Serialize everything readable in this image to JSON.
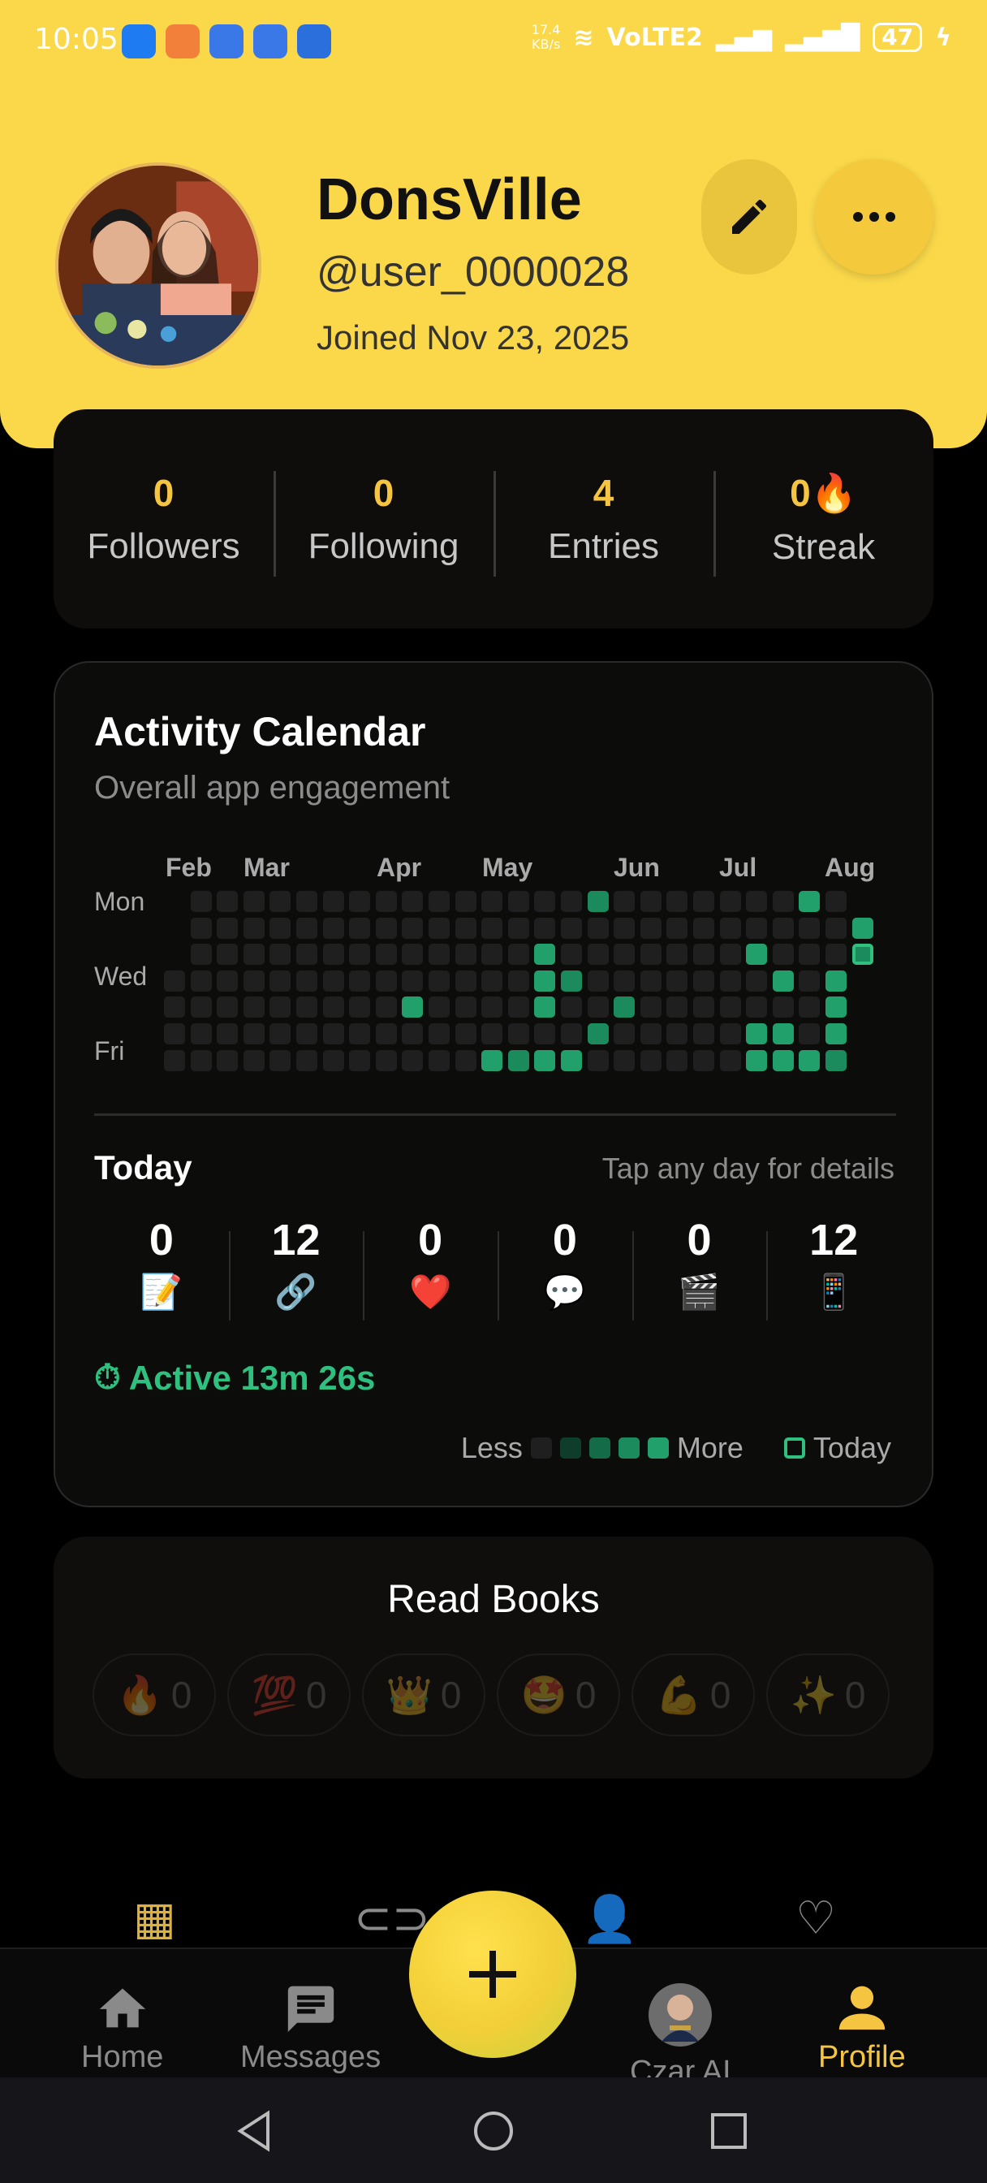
{
  "status_bar": {
    "time": "10:05",
    "speed_value": "17.4",
    "speed_unit": "KB/s",
    "network": "VoLTE2",
    "battery": "47"
  },
  "profile": {
    "name": "DonsVille",
    "handle": "@user_0000028",
    "joined": "Joined Nov 23, 2025",
    "edit_icon": "pencil-icon",
    "more_icon": "more-horizontal-icon"
  },
  "stats": [
    {
      "value": "0",
      "label": "Followers"
    },
    {
      "value": "0",
      "label": "Following"
    },
    {
      "value": "4",
      "label": "Entries"
    },
    {
      "value": "0🔥",
      "label": "Streak"
    }
  ],
  "activity": {
    "title": "Activity Calendar",
    "subtitle": "Overall app engagement",
    "months": [
      "Feb",
      "Mar",
      "Apr",
      "May",
      "Jun",
      "Jul",
      "Aug"
    ],
    "day_labels": [
      "Mon",
      "Wed",
      "Fri"
    ],
    "colors": {
      "empty": "#1f1f1f",
      "level1": "#0f3d2c",
      "level2": "#146b47",
      "level3": "#1b8a5c",
      "level4": "#22a06b",
      "today_border": "#2fbf7f"
    },
    "today_label": "Today",
    "hint": "Tap any day for details",
    "metrics": [
      {
        "value": "0",
        "icon": "📝"
      },
      {
        "value": "12",
        "icon": "🔗"
      },
      {
        "value": "0",
        "icon": "❤️"
      },
      {
        "value": "0",
        "icon": "💬"
      },
      {
        "value": "0",
        "icon": "🎬"
      },
      {
        "value": "12",
        "icon": "📱"
      }
    ],
    "active_text": "Active 13m 26s",
    "legend_less": "Less",
    "legend_more": "More",
    "legend_today": "Today"
  },
  "books": {
    "title": "Read Books",
    "reactions": [
      {
        "emoji": "🔥",
        "count": "0"
      },
      {
        "emoji": "💯",
        "count": "0"
      },
      {
        "emoji": "👑",
        "count": "0"
      },
      {
        "emoji": "🤩",
        "count": "0"
      },
      {
        "emoji": "💪",
        "count": "0"
      },
      {
        "emoji": "✨",
        "count": "0"
      }
    ]
  },
  "nav": {
    "home": "Home",
    "messages": "Messages",
    "czar": "Czar AI",
    "profile": "Profile"
  }
}
